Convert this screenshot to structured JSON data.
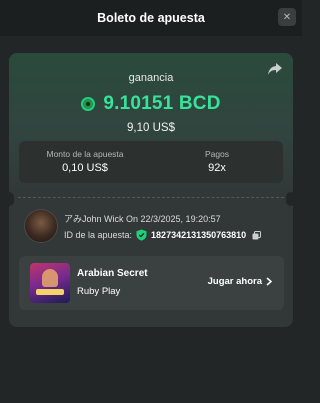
{
  "header": {
    "title": "Boleto de apuesta",
    "close_icon": "close-icon"
  },
  "bet": {
    "gain_label": "ganancia",
    "gain_amount": "9.10151 BCD",
    "gain_usd": "9,10 US$",
    "stake_label": "Monto de la apuesta",
    "stake_value": "0,10 US$",
    "payout_label": "Pagos",
    "payout_value": "92x"
  },
  "user": {
    "line": "アみJohn Wick On 22/3/2025, 19:20:57",
    "id_label": "ID de la apuesta:",
    "id_value": "1827342131350763810"
  },
  "game": {
    "title": "Arabian Secret",
    "provider": "Ruby Play",
    "play_label": "Jugar ahora"
  },
  "colors": {
    "accent": "#39e29b",
    "background": "#232626",
    "card": "#323738"
  }
}
